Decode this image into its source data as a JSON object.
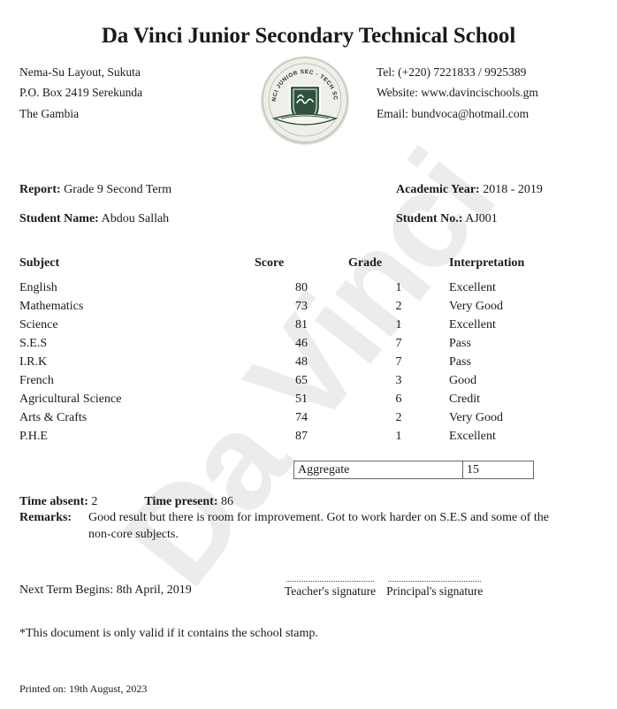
{
  "watermark": {
    "text": "Da Vinci"
  },
  "school": {
    "name": "Da Vinci Junior Secondary Technical School",
    "address": [
      "Nema-Su Layout, Sukuta",
      "P.O. Box 2419 Serekunda",
      "The Gambia"
    ],
    "contact": [
      "Tel: (+220) 7221833 / 9925389",
      "Website: www.davincischools.gm",
      "Email: bundvoca@hotmail.com"
    ],
    "logo": {
      "name": "school-seal-logo",
      "arc_text": "DA VINCI JUNIOR SEC - TECH SCHOOL",
      "shield_color": "#2d5239",
      "disc_color": "#efeee9"
    }
  },
  "meta": {
    "report_label": "Report:",
    "report_value": "Grade 9 Second Term",
    "academic_year_label": "Academic Year:",
    "academic_year_value": "2018 - 2019",
    "student_name_label": "Student Name:",
    "student_name_value": "Abdou Sallah",
    "student_no_label": "Student No.:",
    "student_no_value": "AJ001"
  },
  "scores_table": {
    "headers": [
      "Subject",
      "Score",
      "Grade",
      "Interpretation"
    ],
    "rows": [
      {
        "subject": "English",
        "score": "80",
        "grade": "1",
        "interpretation": "Excellent"
      },
      {
        "subject": "Mathematics",
        "score": "73",
        "grade": "2",
        "interpretation": "Very Good"
      },
      {
        "subject": "Science",
        "score": "81",
        "grade": "1",
        "interpretation": "Excellent"
      },
      {
        "subject": "S.E.S",
        "score": "46",
        "grade": "7",
        "interpretation": "Pass"
      },
      {
        "subject": "I.R.K",
        "score": "48",
        "grade": "7",
        "interpretation": "Pass"
      },
      {
        "subject": "French",
        "score": "65",
        "grade": "3",
        "interpretation": "Good"
      },
      {
        "subject": "Agricultural Science",
        "score": "51",
        "grade": "6",
        "interpretation": "Credit"
      },
      {
        "subject": "Arts & Crafts",
        "score": "74",
        "grade": "2",
        "interpretation": "Very Good"
      },
      {
        "subject": "P.H.E",
        "score": "87",
        "grade": "1",
        "interpretation": "Excellent"
      }
    ]
  },
  "aggregate": {
    "label": "Aggregate",
    "value": "15"
  },
  "attendance": {
    "absent_label": "Time absent:",
    "absent_value": "2",
    "present_label": "Time present:",
    "present_value": "86"
  },
  "remarks": {
    "label": "Remarks:",
    "text": "Good result but there is room for improvement. Got to work harder on S.E.S and some of the non-core subjects."
  },
  "signatures": {
    "next_term_label": "Next Term Begins:",
    "next_term_value": "8th April, 2019",
    "teacher_caption": "Teacher's signature",
    "principal_caption": "Principal's signature"
  },
  "footer": {
    "validity_note": "*This document is only valid if it contains the school stamp.",
    "printed_on": "Printed on: 19th August, 2023"
  }
}
